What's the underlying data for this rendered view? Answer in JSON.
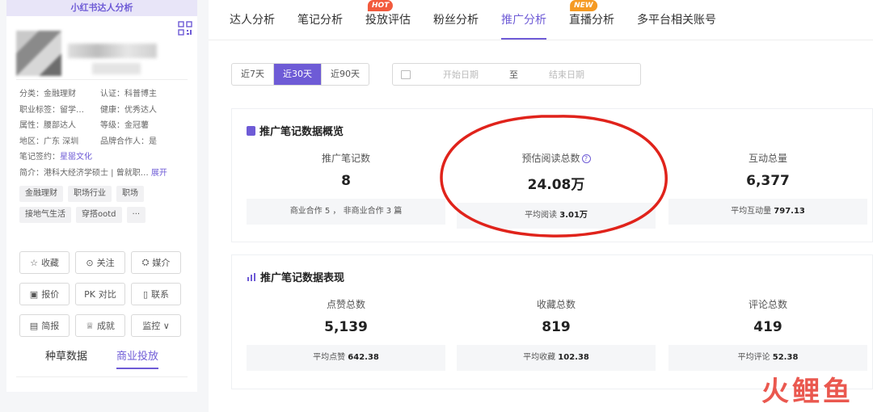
{
  "left_panel": {
    "header": "小红书达人分析",
    "info": [
      {
        "a": "分类：金融理财",
        "b": "认证：科普博主"
      },
      {
        "a": "职业标签：留学…",
        "b": "健康：优秀达人"
      },
      {
        "a": "属性：腰部达人",
        "b": "等级：金冠薯"
      },
      {
        "a": "地区：广东 深圳",
        "b": "品牌合作人：是"
      }
    ],
    "sign_label": "笔记签约：",
    "sign_value": "星罂文化",
    "intro": "简介：港科大经济学硕士 | 曾就职…",
    "expand": "展开",
    "tags": [
      "金融理财",
      "职场行业",
      "职场",
      "接地气生活",
      "穿搭ootd",
      "···"
    ],
    "buttons": [
      {
        "icon": "☆",
        "label": "收藏"
      },
      {
        "icon": "⊙",
        "label": "关注"
      },
      {
        "icon": "⛭",
        "label": "媒介"
      },
      {
        "icon": "▣",
        "label": "报价"
      },
      {
        "icon": "PK",
        "label": "对比"
      },
      {
        "icon": "▯",
        "label": "联系"
      },
      {
        "icon": "▤",
        "label": "简报"
      },
      {
        "icon": "♕",
        "label": "成就"
      },
      {
        "icon": "",
        "label": "监控 ∨"
      }
    ],
    "tabs": [
      "种草数据",
      "商业投放"
    ]
  },
  "nav": {
    "items": [
      {
        "label": "达人分析",
        "badge": ""
      },
      {
        "label": "笔记分析",
        "badge": ""
      },
      {
        "label": "投放评估",
        "badge": "HOT"
      },
      {
        "label": "粉丝分析",
        "badge": ""
      },
      {
        "label": "推广分析",
        "badge": ""
      },
      {
        "label": "直播分析",
        "badge": "NEW"
      },
      {
        "label": "多平台相关账号",
        "badge": ""
      }
    ],
    "active": "推广分析"
  },
  "filter": {
    "ranges": [
      "近7天",
      "近30天",
      "近90天"
    ],
    "active_range": "近30天",
    "start_placeholder": "开始日期",
    "to": "至",
    "end_placeholder": "结束日期"
  },
  "overview": {
    "title": "推广笔记数据概览",
    "metrics": [
      {
        "label": "推广笔记数",
        "value": "8",
        "sub": "商业合作 5 ， 非商业合作 3 篇"
      },
      {
        "label": "预估阅读总数",
        "value": "24.08万",
        "sub_label": "平均阅读",
        "sub_value": "3.01万"
      },
      {
        "label": "互动总量",
        "value": "6,377",
        "sub_label": "平均互动量",
        "sub_value": "797.13"
      }
    ]
  },
  "performance": {
    "title": "推广笔记数据表现",
    "metrics": [
      {
        "label": "点赞总数",
        "value": "5,139",
        "sub_label": "平均点赞",
        "sub_value": "642.38"
      },
      {
        "label": "收藏总数",
        "value": "819",
        "sub_label": "平均收藏",
        "sub_value": "102.38"
      },
      {
        "label": "评论总数",
        "value": "419",
        "sub_label": "平均评论",
        "sub_value": "52.38"
      }
    ]
  },
  "watermark": "火鲤鱼",
  "colors": {
    "accent": "#6e5bd6",
    "hot": "#f25a3d",
    "new": "#f59a23",
    "annotation": "#e0231b"
  }
}
